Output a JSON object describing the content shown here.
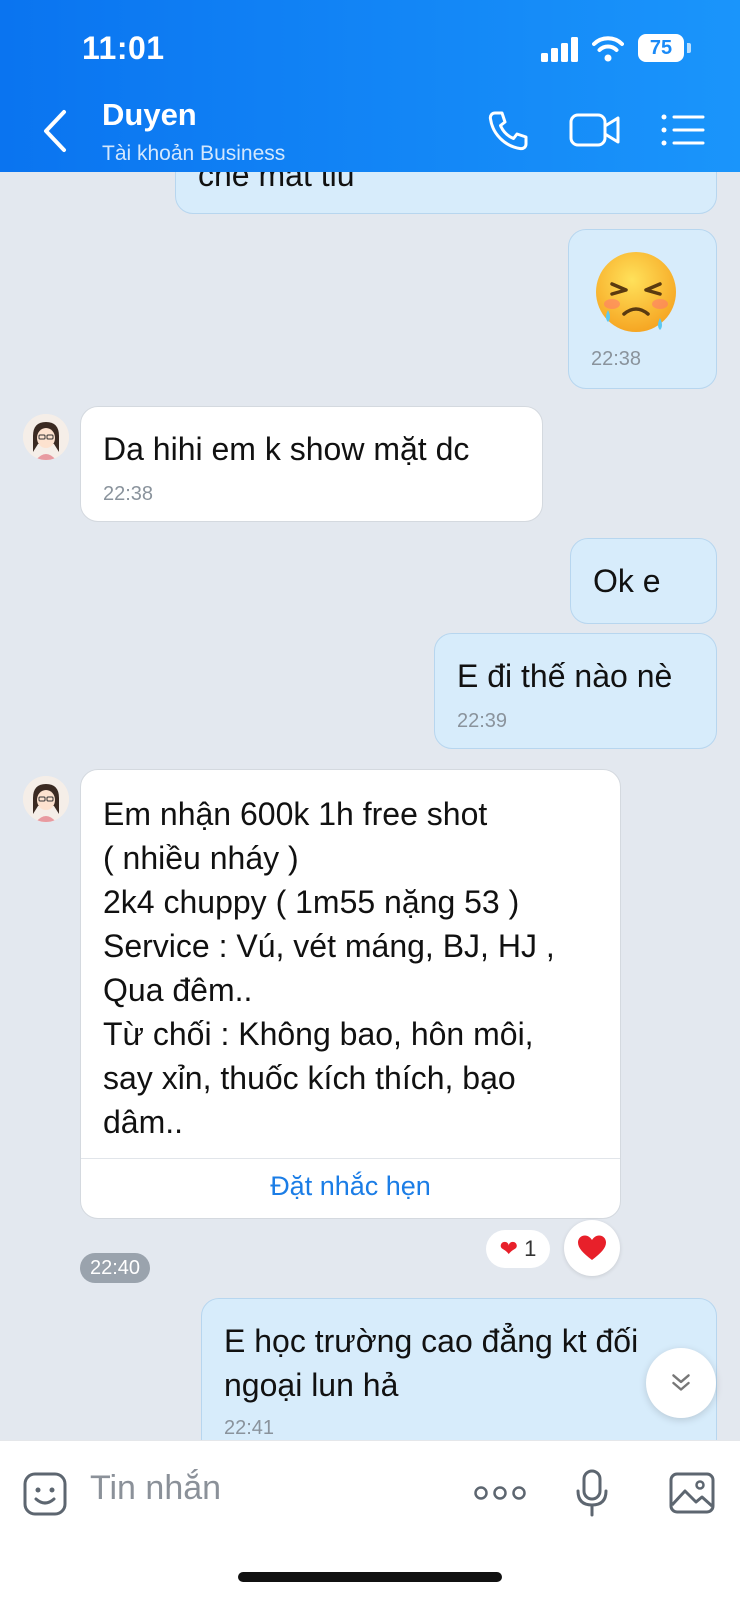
{
  "status_bar": {
    "time": "11:01",
    "battery": "75"
  },
  "header": {
    "name": "Duyen",
    "subtitle": "Tài khoản Business"
  },
  "messages": {
    "m0": {
      "text": "che mat tiu"
    },
    "m1": {
      "emoji": "😣",
      "time": "22:38"
    },
    "m2": {
      "text": "Da hihi em k show mặt dc",
      "time": "22:38"
    },
    "m3": {
      "text": "Ok e"
    },
    "m4": {
      "text": "E đi thế nào nè",
      "time": "22:39"
    },
    "m5": {
      "text": "Em nhận 600k 1h free shot\n( nhiều nháy )\n2k4 chuppy ( 1m55 nặng 53 )\nService : Vú, vét máng, BJ, HJ ,\nQua đêm..\nTừ chối : Không bao, hôn môi,\nsay xỉn, thuốc kích thích, bạo\ndâm..",
      "reminder": "Đặt nhắc hẹn",
      "time": "22:40",
      "reaction_count": "1"
    },
    "m6": {
      "text": "E học trường cao đẳng kt đối\nngoại lun hả",
      "time": "22:41"
    }
  },
  "composer": {
    "placeholder": "Tin nhắn"
  },
  "colors": {
    "header_start": "#0a74f0",
    "header_end": "#1a95fb",
    "my_bubble": "#d7ecfb",
    "their_bubble": "#ffffff",
    "chat_bg": "#e3e8ef",
    "link": "#1b7de6"
  }
}
